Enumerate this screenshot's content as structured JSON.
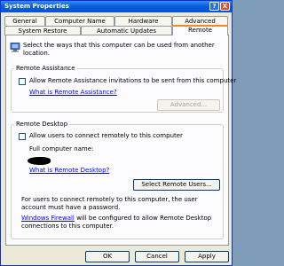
{
  "window": {
    "title": "System Properties",
    "help": "?",
    "close": "X"
  },
  "tabs": {
    "general": "General",
    "computer_name": "Computer Name",
    "hardware": "Hardware",
    "advanced": "Advanced",
    "system_restore": "System Restore",
    "automatic_updates": "Automatic Updates",
    "remote": "Remote"
  },
  "intro": "Select the ways that this computer can be used from another location.",
  "remote_assistance": {
    "group": "Remote Assistance",
    "allow": "Allow Remote Assistance invitations to be sent from this computer",
    "what_link": "What is Remote Assistance?",
    "advanced_button": "Advanced..."
  },
  "remote_desktop": {
    "group": "Remote Desktop",
    "allow": "Allow users to connect remotely to this computer",
    "full_name_label": "Full computer name:",
    "what_link": "What is Remote Desktop?",
    "select_users_button": "Select Remote Users...",
    "password_note": "For users to connect remotely to this computer, the user account must have a password.",
    "firewall_link": "Windows Firewall",
    "firewall_note": " will be configured to allow Remote Desktop connections to this computer."
  },
  "footer": {
    "ok": "OK",
    "cancel": "Cancel",
    "apply": "Apply"
  }
}
